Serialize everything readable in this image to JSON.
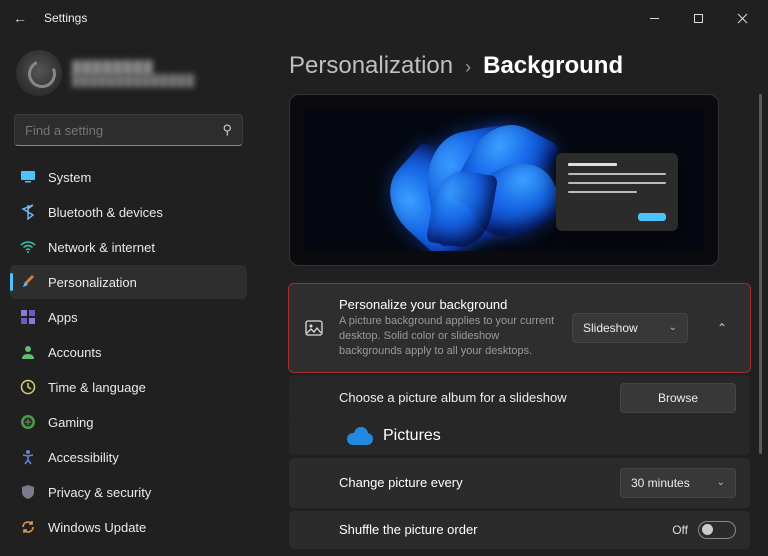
{
  "window": {
    "title": "Settings"
  },
  "profile": {
    "name": "████████",
    "email": "██████████████"
  },
  "search": {
    "placeholder": "Find a setting"
  },
  "sidebar": {
    "items": [
      {
        "label": "System"
      },
      {
        "label": "Bluetooth & devices"
      },
      {
        "label": "Network & internet"
      },
      {
        "label": "Personalization"
      },
      {
        "label": "Apps"
      },
      {
        "label": "Accounts"
      },
      {
        "label": "Time & language"
      },
      {
        "label": "Gaming"
      },
      {
        "label": "Accessibility"
      },
      {
        "label": "Privacy & security"
      },
      {
        "label": "Windows Update"
      }
    ],
    "active_index": 3
  },
  "breadcrumb": {
    "parent": "Personalization",
    "separator": "›",
    "current": "Background"
  },
  "settings": {
    "personalize": {
      "title": "Personalize your background",
      "desc": "A picture background applies to your current desktop. Solid color or slideshow backgrounds apply to all your desktops.",
      "select_value": "Slideshow"
    },
    "album": {
      "title": "Choose a picture album for a slideshow",
      "button": "Browse",
      "folder": "Pictures"
    },
    "interval": {
      "title": "Change picture every",
      "select_value": "30 minutes"
    },
    "shuffle": {
      "title": "Shuffle the picture order",
      "state": "Off"
    }
  }
}
